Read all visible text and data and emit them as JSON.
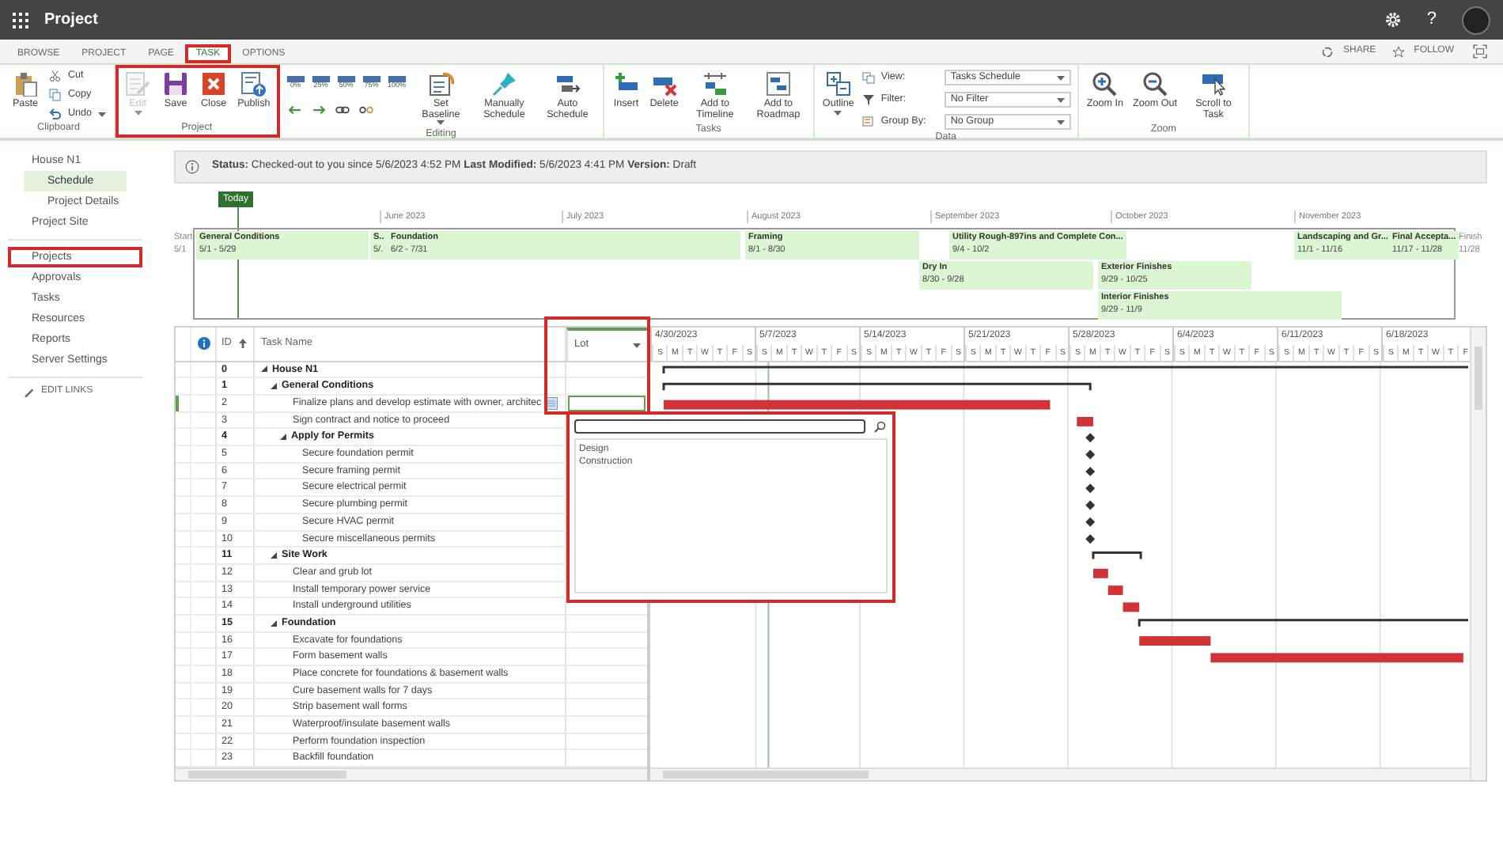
{
  "app": {
    "title": "Project",
    "help": "?"
  },
  "tabs": [
    {
      "label": "BROWSE",
      "selected": false,
      "highlighted": false
    },
    {
      "label": "PROJECT",
      "selected": false,
      "highlighted": false
    },
    {
      "label": "PAGE",
      "selected": false,
      "highlighted": false
    },
    {
      "label": "TASK",
      "selected": true,
      "highlighted": true
    },
    {
      "label": "OPTIONS",
      "selected": false,
      "highlighted": false
    }
  ],
  "header_actions": [
    "SHARE",
    "FOLLOW"
  ],
  "ribbon": [
    {
      "label": "Clipboard",
      "highlighted": false,
      "buttons": [
        {
          "kind": "large",
          "label": "Paste"
        },
        {
          "kind": "small",
          "label": "Cut"
        },
        {
          "kind": "small",
          "label": "Copy"
        },
        {
          "kind": "small-menu",
          "label": "Undo"
        }
      ]
    },
    {
      "label": "Project",
      "highlighted": true,
      "buttons": [
        {
          "kind": "large-menu",
          "label": "Edit",
          "disabled": true
        },
        {
          "kind": "large",
          "label": "Save",
          "disabled": false
        },
        {
          "kind": "large",
          "label": "Close",
          "disabled": false
        },
        {
          "kind": "large",
          "label": "Publish",
          "disabled": false
        }
      ]
    },
    {
      "label": "Editing",
      "highlighted": false,
      "buttons": [
        {
          "kind": "percent",
          "label": "0%"
        },
        {
          "kind": "percent",
          "label": "25%"
        },
        {
          "kind": "percent",
          "label": "50%"
        },
        {
          "kind": "percent",
          "label": "75%"
        },
        {
          "kind": "percent",
          "label": "100%"
        },
        {
          "kind": "icon"
        },
        {
          "kind": "icon"
        },
        {
          "kind": "icon"
        },
        {
          "kind": "icon"
        },
        {
          "kind": "large-menu",
          "label": "Set Baseline"
        },
        {
          "kind": "large",
          "label": "Manually Schedule"
        },
        {
          "kind": "large",
          "label": "Auto Schedule"
        }
      ]
    },
    {
      "label": "Tasks",
      "highlighted": false,
      "buttons": [
        {
          "kind": "large",
          "label": "Insert"
        },
        {
          "kind": "large",
          "label": "Delete"
        },
        {
          "kind": "large",
          "label": "Add to Timeline"
        },
        {
          "kind": "large",
          "label": "Add to Roadmap"
        }
      ]
    },
    {
      "label": "Data",
      "highlighted": false,
      "buttons": [
        {
          "kind": "large-menu",
          "label": "Outline"
        },
        {
          "kind": "select",
          "label": "View:",
          "value": "Tasks Schedule"
        },
        {
          "kind": "select",
          "label": "Filter:",
          "value": "No Filter"
        },
        {
          "kind": "select",
          "label": "Group By:",
          "value": "No Group"
        }
      ]
    },
    {
      "label": "Zoom",
      "highlighted": false,
      "buttons": [
        {
          "kind": "large",
          "label": "Zoom In"
        },
        {
          "kind": "large",
          "label": "Zoom Out"
        },
        {
          "kind": "large",
          "label": "Scroll to Task"
        }
      ]
    }
  ],
  "nav": {
    "groups": [
      [
        {
          "label": "House N1",
          "selected": false,
          "highlighted": false,
          "children": [
            {
              "label": "Schedule",
              "selected": true,
              "highlighted": false
            },
            {
              "label": "Project Details",
              "selected": false,
              "highlighted": false
            }
          ]
        },
        {
          "label": "Project Site",
          "selected": false,
          "highlighted": false
        }
      ],
      [
        {
          "label": "Projects",
          "selected": false,
          "highlighted": true
        },
        {
          "label": "Approvals",
          "selected": false,
          "highlighted": false
        },
        {
          "label": "Tasks",
          "selected": false,
          "highlighted": false
        },
        {
          "label": "Resources",
          "selected": false,
          "highlighted": false
        },
        {
          "label": "Reports",
          "selected": false,
          "highlighted": false
        },
        {
          "label": "Server Settings",
          "selected": false,
          "highlighted": false
        }
      ]
    ],
    "edit_links": "EDIT LINKS"
  },
  "status": "**Status:** Checked-out to you since 5/6/2023 4:52 PM **Last Modified:** 5/6/2023 4:41 PM **Version:** Draft",
  "timeline": {
    "today": "Today",
    "start_label": "Start",
    "start_date": "5/1",
    "finish_label": "Finish",
    "finish_date": "11/28",
    "months": [
      "June 2023",
      "July 2023",
      "August 2023",
      "September 2023",
      "October 2023",
      "November 2023"
    ],
    "lanes": [
      [
        {
          "name": "General Conditions",
          "dates": "5/1 - 5/29"
        },
        {
          "name": "S..",
          "dates": "5/."
        },
        {
          "name": "Foundation",
          "dates": "6/2 - 7/31"
        },
        {
          "name": "Framing",
          "dates": "8/1 - 8/30"
        },
        {
          "name": "Utility Rough-897ins and Complete Con...",
          "dates": "9/4 - 10/2"
        },
        {
          "name": "Landscaping and Gr...",
          "dates": "11/1 - 11/16"
        },
        {
          "name": "Final Accepta...",
          "dates": "11/17 - 11/28"
        }
      ],
      [
        {
          "name": "Dry In",
          "dates": "8/30 - 9/28"
        },
        {
          "name": "Exterior Finishes",
          "dates": "9/29 - 10/25"
        }
      ],
      [
        {
          "name": "Interior Finishes",
          "dates": "9/29 - 11/9"
        }
      ]
    ]
  },
  "grid": {
    "columns": [
      {
        "label": "ID"
      },
      {
        "label": "Task Name"
      },
      {
        "label": "Lot",
        "highlighted": true
      }
    ]
  },
  "tasks": [
    {
      "id": "0",
      "name": "House N1",
      "selected": false,
      "expanded": true,
      "children": [
        {
          "id": "1",
          "name": "General Conditions",
          "selected": false,
          "expanded": true,
          "children": [
            {
              "id": "2",
              "name": "Finalize plans and develop estimate with owner, architec",
              "selected": true
            },
            {
              "id": "3",
              "name": "Sign contract and notice to proceed",
              "selected": false
            },
            {
              "id": "4",
              "name": "Apply for Permits",
              "selected": false,
              "expanded": true,
              "children": [
                {
                  "id": "5",
                  "name": "Secure foundation permit",
                  "selected": false
                },
                {
                  "id": "6",
                  "name": "Secure framing permit",
                  "selected": false
                },
                {
                  "id": "7",
                  "name": "Secure electrical permit",
                  "selected": false
                },
                {
                  "id": "8",
                  "name": "Secure plumbing permit",
                  "selected": false
                },
                {
                  "id": "9",
                  "name": "Secure HVAC permit",
                  "selected": false
                },
                {
                  "id": "10",
                  "name": "Secure miscellaneous permits",
                  "selected": false
                }
              ]
            }
          ]
        },
        {
          "id": "11",
          "name": "Site Work",
          "selected": false,
          "expanded": true,
          "children": [
            {
              "id": "12",
              "name": "Clear and grub lot",
              "selected": false
            },
            {
              "id": "13",
              "name": "Install temporary power service",
              "selected": false
            },
            {
              "id": "14",
              "name": "Install underground utilities",
              "selected": false
            }
          ]
        },
        {
          "id": "15",
          "name": "Foundation",
          "selected": false,
          "expanded": true,
          "children": [
            {
              "id": "16",
              "name": "Excavate for foundations",
              "selected": false
            },
            {
              "id": "17",
              "name": "Form basement walls",
              "selected": false
            },
            {
              "id": "18",
              "name": "Place concrete for foundations & basement walls",
              "selected": false
            },
            {
              "id": "19",
              "name": "Cure basement walls for 7 days",
              "selected": false
            },
            {
              "id": "20",
              "name": "Strip basement wall forms",
              "selected": false
            },
            {
              "id": "21",
              "name": "Waterproof/insulate basement walls",
              "selected": false
            },
            {
              "id": "22",
              "name": "Perform foundation inspection",
              "selected": false
            },
            {
              "id": "23",
              "name": "Backfill foundation",
              "selected": false
            }
          ]
        }
      ]
    }
  ],
  "lot_dropdown": {
    "highlighted": true,
    "options": [
      "Design",
      "Construction"
    ]
  },
  "gantt": {
    "weeks": [
      {
        "label": "4/30/2023",
        "days": [
          "S",
          "M",
          "T",
          "W",
          "T",
          "F",
          "S"
        ]
      },
      {
        "label": "5/7/2023",
        "days": [
          "S",
          "M",
          "T",
          "W",
          "T",
          "F",
          "S"
        ]
      },
      {
        "label": "5/14/2023",
        "days": [
          "S",
          "M",
          "T",
          "W",
          "T",
          "F",
          "S"
        ]
      },
      {
        "label": "5/21/2023",
        "days": [
          "S",
          "M",
          "T",
          "W",
          "T",
          "F",
          "S"
        ]
      },
      {
        "label": "5/28/2023",
        "days": [
          "S",
          "M",
          "T",
          "W",
          "T",
          "F",
          "S"
        ]
      },
      {
        "label": "6/4/2023",
        "days": [
          "S",
          "M",
          "T",
          "W",
          "T",
          "F",
          "S"
        ]
      },
      {
        "label": "6/11/2023",
        "days": [
          "S",
          "M",
          "T",
          "W",
          "T",
          "F",
          "S"
        ]
      },
      {
        "label": "6/18/2023",
        "days": [
          "S",
          "M",
          "T",
          "W",
          "T",
          "F"
        ]
      }
    ]
  }
}
